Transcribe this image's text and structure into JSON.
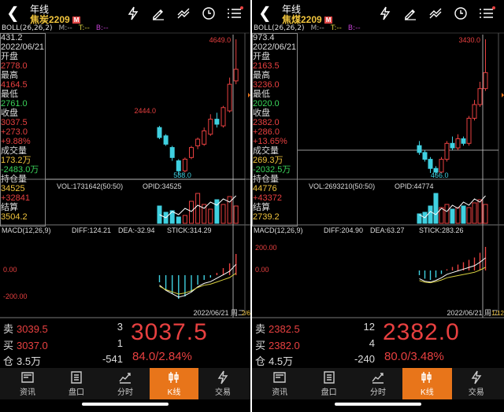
{
  "colors": {
    "up": "#e84040",
    "down": "#3fd0e0",
    "accent": "#e8751a",
    "yellow": "#f0c43d",
    "green": "#3ad45a"
  },
  "panels": [
    {
      "period": "年线",
      "contract": "焦炭2209",
      "badge": "M",
      "boll": {
        "label": "BOLL(26,26,2)",
        "m": "M:--",
        "t": "T:--",
        "b": "B:--"
      },
      "info": [
        {
          "text": "431.2",
          "color": "#ddd"
        },
        {
          "text": "2022/06/21",
          "color": "#ddd"
        },
        {
          "text": "开盘",
          "color": "#ddd"
        },
        {
          "text": "2778.0",
          "color": "#e84040"
        },
        {
          "text": "最高",
          "color": "#ddd"
        },
        {
          "text": "4164.5",
          "color": "#e84040"
        },
        {
          "text": "最低",
          "color": "#ddd"
        },
        {
          "text": "2761.0",
          "color": "#3ad45a"
        },
        {
          "text": "收盘",
          "color": "#ddd"
        },
        {
          "text": "3037.5",
          "color": "#e84040"
        },
        {
          "text": "+273.0",
          "color": "#e84040"
        },
        {
          "text": "+9.88%",
          "color": "#e84040"
        },
        {
          "text": "成交量",
          "color": "#ddd"
        },
        {
          "text": "173.2万",
          "color": "#f0c43d"
        },
        {
          "text": "-2483.0万",
          "color": "#3ad45a"
        },
        {
          "text": "持仓量",
          "color": "#ddd"
        },
        {
          "text": "34525",
          "color": "#f0c43d"
        },
        {
          "text": "+32841",
          "color": "#e84040"
        },
        {
          "text": "结算",
          "color": "#ddd"
        },
        {
          "text": "3504.2",
          "color": "#f0c43d"
        }
      ],
      "high_label": "4649.0",
      "mid_label": "2444.0",
      "low_label": "588.0",
      "vol_label": "VOL:1731642(50:50)",
      "opid_label": "OPID:34525",
      "macd": {
        "label": "MACD(12,26,9)",
        "diff": "DIFF:124.21",
        "dea": "DEA:-32.94",
        "stick": "STICK:314.29"
      },
      "macd_ticks": [
        "0.00",
        "-200.00"
      ],
      "date_label": "2022/06/21 周二",
      "date_extra": "2/6",
      "sell": {
        "label": "卖",
        "price": "3039.5",
        "qty": "3"
      },
      "buy": {
        "label": "买",
        "price": "3037.0",
        "qty": "1"
      },
      "oi": {
        "label": "仓",
        "value": "3.5万",
        "change": "-541"
      },
      "last_price": "3037.5",
      "change_line": "84.0/2.84%",
      "candles": [
        {
          "o": 2000,
          "c": 1700,
          "h": 2050,
          "l": 1650
        },
        {
          "o": 1750,
          "c": 1500,
          "h": 1800,
          "l": 1450
        },
        {
          "o": 1400,
          "c": 1100,
          "h": 1450,
          "l": 1000
        },
        {
          "o": 1000,
          "c": 700,
          "h": 1050,
          "l": 588
        },
        {
          "o": 700,
          "c": 1050,
          "h": 1100,
          "l": 650
        },
        {
          "o": 1100,
          "c": 1400,
          "h": 1450,
          "l": 1050
        },
        {
          "o": 1450,
          "c": 1650,
          "h": 1700,
          "l": 1350
        },
        {
          "o": 1500,
          "c": 1900,
          "h": 2000,
          "l": 1450
        },
        {
          "o": 1800,
          "c": 2250,
          "h": 2400,
          "l": 1750
        },
        {
          "o": 2250,
          "c": 2100,
          "h": 2444,
          "l": 2000
        },
        {
          "o": 2050,
          "c": 2600,
          "h": 2650,
          "l": 2000
        },
        {
          "o": 2500,
          "c": 3300,
          "h": 3500,
          "l": 2450
        },
        {
          "o": 3400,
          "c": 3750,
          "h": 4649,
          "l": 3300
        }
      ],
      "vols": [
        0.55,
        0.35,
        0.4,
        0.2,
        0.25,
        0.7,
        0.95,
        0.6,
        0.45,
        0.75,
        0.6,
        0.85,
        0.55
      ],
      "macd_bars": [
        -0.3,
        -0.6,
        -0.8,
        -1.0,
        -0.9,
        -0.7,
        -0.4,
        -0.2,
        -0.1,
        0.1,
        0.3,
        0.5,
        0.9
      ]
    },
    {
      "period": "年线",
      "contract": "焦煤2209",
      "badge": "M",
      "boll": {
        "label": "BOLL(26,26,2)",
        "m": "M:--",
        "t": "T:--",
        "b": "B:--"
      },
      "info": [
        {
          "text": "973.4",
          "color": "#ddd"
        },
        {
          "text": "2022/06/21",
          "color": "#ddd"
        },
        {
          "text": "开盘",
          "color": "#ddd"
        },
        {
          "text": "2163.5",
          "color": "#e84040"
        },
        {
          "text": "最高",
          "color": "#ddd"
        },
        {
          "text": "3236.0",
          "color": "#e84040"
        },
        {
          "text": "最低",
          "color": "#ddd"
        },
        {
          "text": "2020.0",
          "color": "#3ad45a"
        },
        {
          "text": "收盘",
          "color": "#ddd"
        },
        {
          "text": "2382.0",
          "color": "#e84040"
        },
        {
          "text": "+286.0",
          "color": "#e84040"
        },
        {
          "text": "+13.65%",
          "color": "#e84040"
        },
        {
          "text": "成交量",
          "color": "#ddd"
        },
        {
          "text": "269.3万",
          "color": "#f0c43d"
        },
        {
          "text": "-2032.5万",
          "color": "#3ad45a"
        },
        {
          "text": "持仓量",
          "color": "#ddd"
        },
        {
          "text": "44776",
          "color": "#f0c43d"
        },
        {
          "text": "+43372",
          "color": "#e84040"
        },
        {
          "text": "结算",
          "color": "#ddd"
        },
        {
          "text": "2739.2",
          "color": "#f0c43d"
        }
      ],
      "high_label": "3430.0",
      "mid_label": "",
      "low_label": "466.0",
      "vol_label": "VOL:2693210(50:50)",
      "opid_label": "OPID:44774",
      "macd": {
        "label": "MACD(12,26,9)",
        "diff": "DIFF:204.90",
        "dea": "DEA:63.27",
        "stick": "STICK:283.26"
      },
      "macd_ticks": [
        "200.00",
        "0.00"
      ],
      "date_label": "2022/06/21 周二",
      "date_extra": "1/12",
      "sell": {
        "label": "卖",
        "price": "2382.5",
        "qty": "12"
      },
      "buy": {
        "label": "买",
        "price": "2382.0",
        "qty": "4"
      },
      "oi": {
        "label": "仓",
        "value": "4.5万",
        "change": "-240"
      },
      "last_price": "2382.0",
      "change_line": "80.0/3.48%",
      "candles": [
        {
          "o": 1100,
          "c": 950,
          "h": 1200,
          "l": 900
        },
        {
          "o": 950,
          "c": 800,
          "h": 1000,
          "l": 750
        },
        {
          "o": 800,
          "c": 600,
          "h": 850,
          "l": 500
        },
        {
          "o": 600,
          "c": 520,
          "h": 650,
          "l": 466
        },
        {
          "o": 520,
          "c": 800,
          "h": 850,
          "l": 500
        },
        {
          "o": 800,
          "c": 1150,
          "h": 1200,
          "l": 750
        },
        {
          "o": 1150,
          "c": 1050,
          "h": 1300,
          "l": 1000
        },
        {
          "o": 1050,
          "c": 1250,
          "h": 1350,
          "l": 1000
        },
        {
          "o": 1250,
          "c": 1150,
          "h": 1300,
          "l": 1100
        },
        {
          "o": 1150,
          "c": 1700,
          "h": 1750,
          "l": 1100
        },
        {
          "o": 1700,
          "c": 2000,
          "h": 2100,
          "l": 1650
        },
        {
          "o": 2000,
          "c": 2350,
          "h": 2500,
          "l": 1950
        },
        {
          "o": 2350,
          "c": 2700,
          "h": 3430,
          "l": 2300
        }
      ],
      "vols": [
        0.3,
        0.35,
        0.55,
        0.95,
        0.5,
        0.6,
        0.45,
        0.5,
        0.55,
        0.5,
        0.65,
        0.75,
        0.6
      ],
      "macd_bars": [
        -0.2,
        -0.35,
        -0.4,
        -0.3,
        -0.15,
        0.05,
        0.15,
        0.25,
        0.35,
        0.45,
        0.55,
        0.75,
        1.0
      ]
    }
  ],
  "nav": [
    {
      "label": "资讯",
      "icon": "news-icon"
    },
    {
      "label": "盘口",
      "icon": "orderbook-icon"
    },
    {
      "label": "分时",
      "icon": "timeshare-icon"
    },
    {
      "label": "K线",
      "icon": "candlestick-icon",
      "active": true
    },
    {
      "label": "交易",
      "icon": "trade-icon"
    }
  ]
}
